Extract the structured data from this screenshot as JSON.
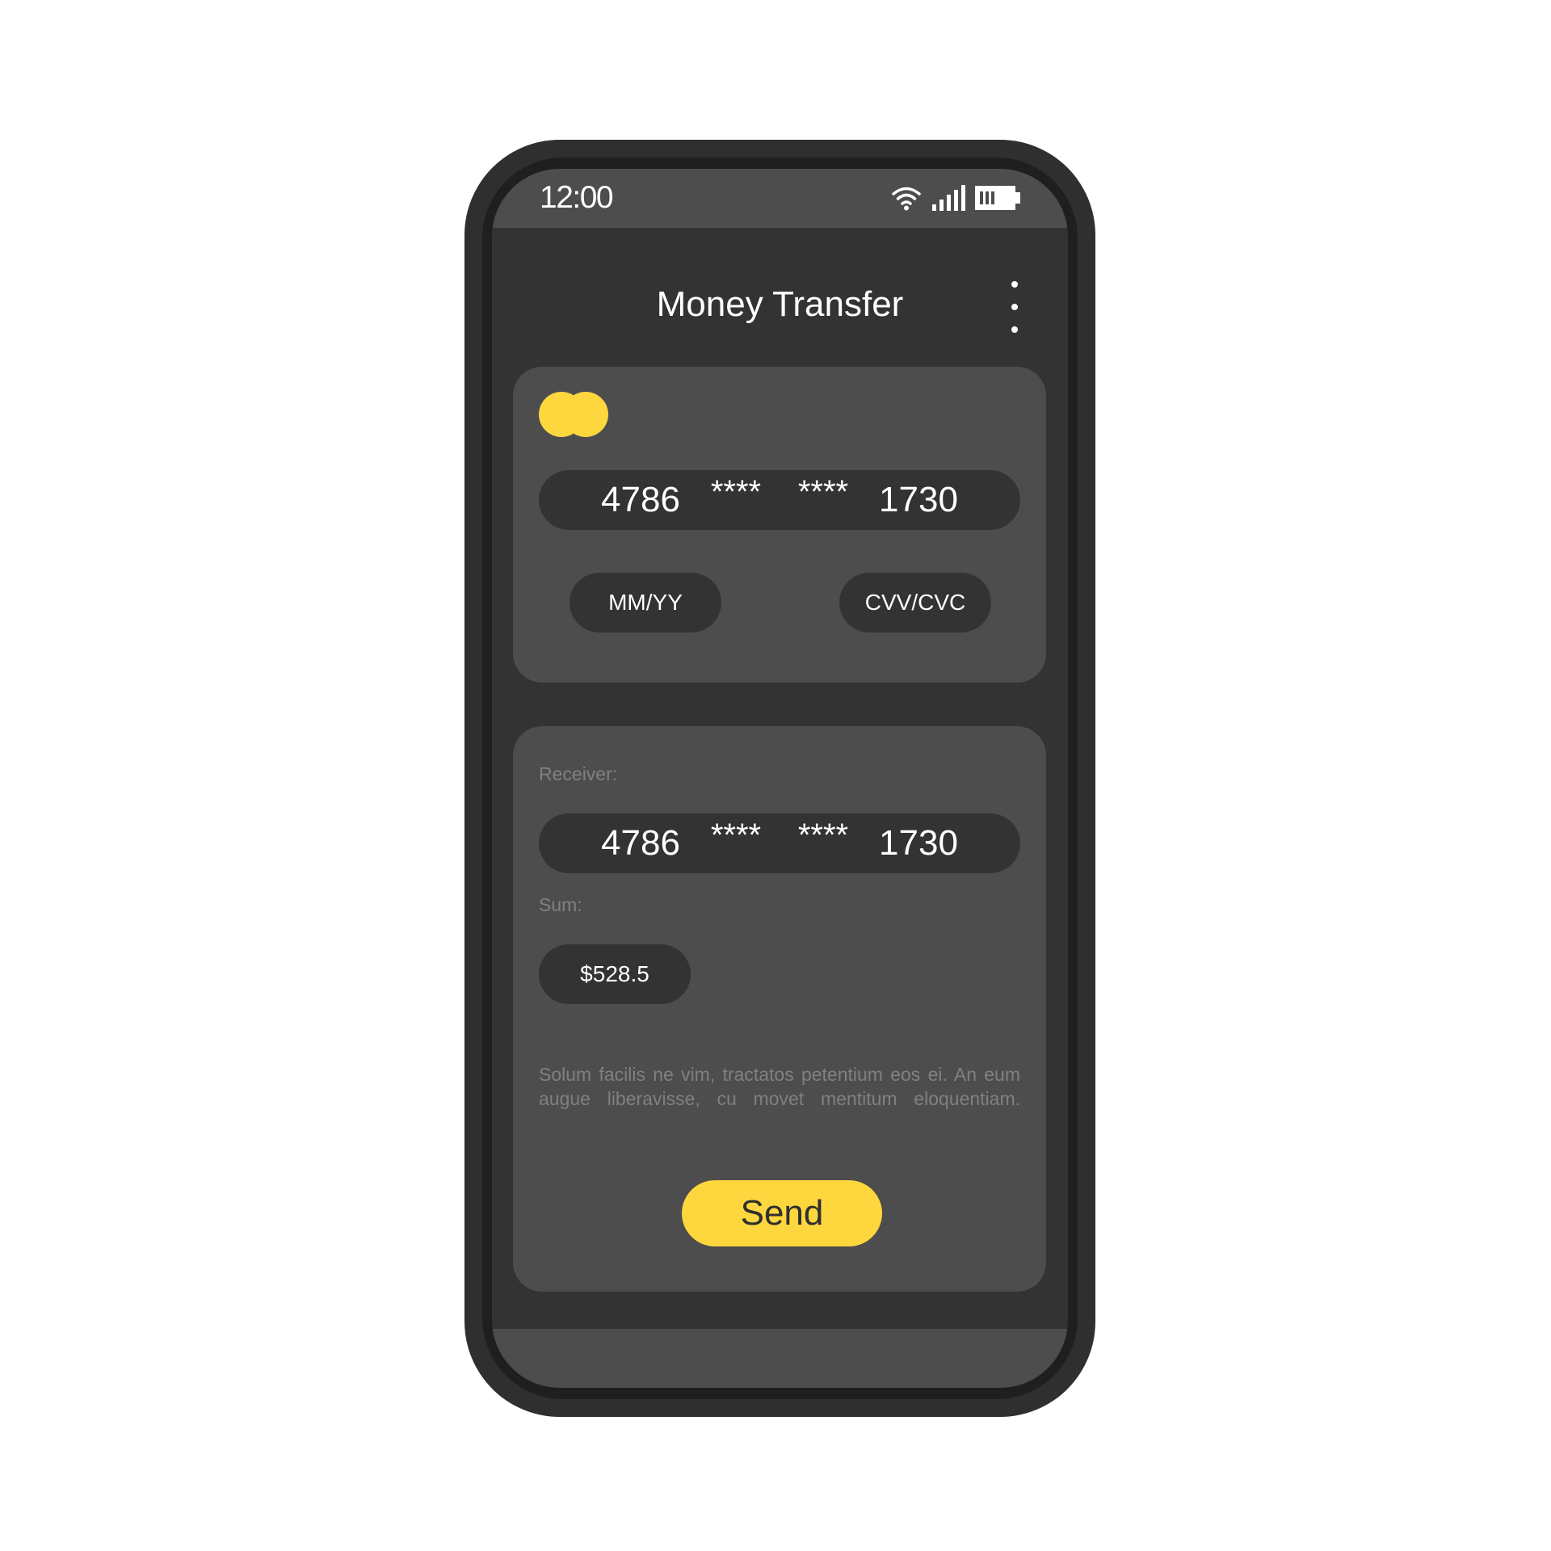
{
  "status_bar": {
    "time": "12:00",
    "icons": [
      "wifi-icon",
      "signal-icon",
      "battery-icon"
    ]
  },
  "header": {
    "title": "Money Transfer",
    "menu_icon": "more-vertical-icon"
  },
  "sender_card": {
    "chip_icon": "card-chip-icon",
    "number_groups": [
      "4786",
      "****",
      "****",
      "1730"
    ],
    "expiry_placeholder": "MM/YY",
    "cvv_placeholder": "CVV/CVC"
  },
  "receiver": {
    "label": "Receiver:",
    "number_groups": [
      "4786",
      "****",
      "****",
      "1730"
    ],
    "sum_label": "Sum:",
    "sum_value": "$528.5",
    "description": "Solum facilis ne vim, tractatos petentium eos ei. An eum augue liberavisse, cu movet mentitum eloquentiam.",
    "send_label": "Send"
  },
  "colors": {
    "accent": "#fdd73d",
    "screen_bg": "#333333",
    "panel_bg": "#4d4d4d",
    "frame": "#2f2f2f",
    "muted_text": "#808080"
  }
}
